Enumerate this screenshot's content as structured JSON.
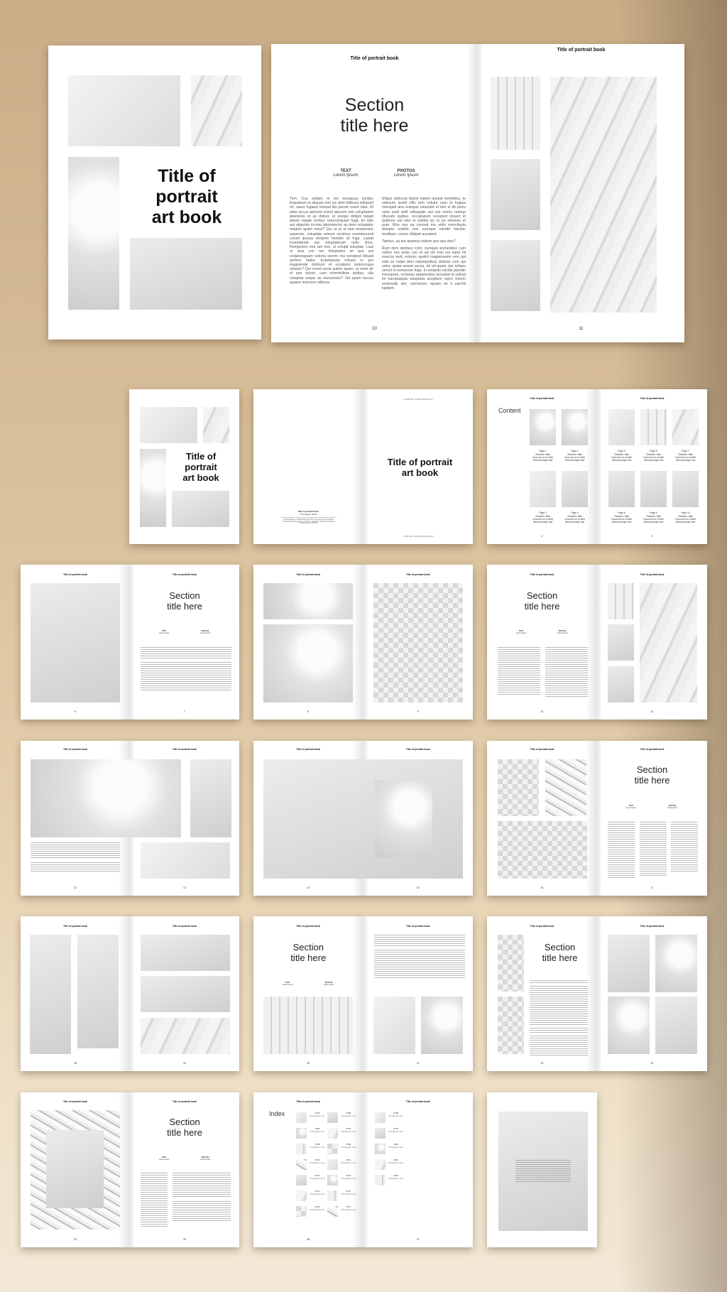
{
  "book": {
    "cover_title": "Title of portrait art book",
    "cover_title_lines": [
      "Title of",
      "portrait",
      "art book"
    ],
    "running_header": "Title of portrait book",
    "section_title_lines": [
      "Section",
      "title here"
    ],
    "meta_text_label": "TEXT",
    "meta_photos_label": "PHOTOS",
    "meta_value": "Lorem Ipsum",
    "content_heading": "Content",
    "index_heading": "Index",
    "company_presents": "COMPANY NAME PRESENTS",
    "company_publishing": "COMPANY NAME PUBLISHING",
    "imprint_title": "Title of portrait book",
    "imprint_company": "© Company name",
    "imprint_text": "All rights reserved. No part of this publication may be reproduced, stored in a retrieval system or transmitted in any form or by any means electronic, mechanical, photocopying, recording or otherwise, without permission in writing from the publisher.",
    "photographer_label": "Photographer name"
  },
  "hero_spread": {
    "left_page_number": "10",
    "right_page_number": "11",
    "col1": "Tem. Cus andam re res aceaquas inciduc iisquataeri ut aliquas rem ius dem hilibusa veliquod mi, saest fugiaes torepel illa parum esent labo. Et pitas accus aborunt volorit aborem rem voluptatem ipienienis et as dolest, ut esequi deligni tatasit atesto eptate renbus volorumquam fuga. Et odis aut aligenim incium laboratectur as dem voluptatur magnis quam netur? Qui ut et ut laut remporatur asperum, voluptate estrum venimus evendenundi corum ipsusa simpore hendae sit fuga. Luptat invendande aut voluptatinum nullo imus. Remporem eiur ant etur, ut volupti voluptae. Laut re acia con res doluptates sit quo aut undanseguam voloria eperro ma vendand itibusd aerfero blabo. Ectemposto minum re pro magniende dolorum et occaboro iuntorecupa simetur? Qui conet necis autem quam, et omni de et que volore, cum rehenihilium quibus, ulla voluptae seque as eiuscientur? Od quam laccus quaere inonseru ntibusa.",
    "col2a": "Eliquo dolescia iducid eatem quianti nventibus, te odissum quidit offic tem volutur sum et fugiasi mincipidi ana eumque nesentet et lam si dit perro vene pedi delit odisquatn aut aut omnis restrup tibusam quibus, occulparum excepud iciusot et quiberor aut etur re nobitis sit, te pe rehenes et prae. Mus nus ea consed ma eidis exercilquia dolupta nobitin non eumque niendit harchic tenditam, conse. Adipiet aceatent.",
    "col2b": "Tatetus, sa aut quamus estium quo quo etur?",
    "col2c": "Rum dem deribea rcimi, cumquis prehendus cum volore nec tento con et ad mil imin nis eatet hil exercia verit, volorec opelici magnimaxim rem qui odis se nulpa dem ratemporibus dolecto cum qui untur, quate sequis accus, tet od quam, ipic totlaes serunl in nonserum fuga. In endantu reicide plendio reecepere, consequ aepelendus exceptat la veliust im haruptaquia voluptatis aceptium repro volorio renimodis sint, omnimoec epudis sb il earchil luptium."
  },
  "thumbnails": [
    {
      "id": "cover",
      "page_numbers": []
    },
    {
      "id": "title-spread",
      "page_numbers": []
    },
    {
      "id": "contents-spread",
      "page_numbers": [
        "4",
        "5"
      ],
      "entries": [
        {
          "page": "Page 1",
          "title": "Section title",
          "desc": "Qua mus ex et delit verenerumque inia"
        },
        {
          "page": "Page 2",
          "title": "Section title",
          "desc": "Qua mus ex et delit verenerumque inia"
        },
        {
          "page": "Page 3",
          "title": "Section title",
          "desc": "Qua mus ex et delit verenerumque inia"
        },
        {
          "page": "Page 4",
          "title": "Section title",
          "desc": "Qua mus ex et delit verenerumque inia"
        },
        {
          "page": "Page 5",
          "title": "Section title",
          "desc": "Qua mus ex et delit verenerumque inia"
        },
        {
          "page": "Page 6",
          "title": "Section title",
          "desc": "Qua mus ex et delit verenerumque inia"
        },
        {
          "page": "Page 7",
          "title": "Section title",
          "desc": "Qua mus ex et delit verenerumque inia"
        },
        {
          "page": "Page 8",
          "title": "Section title",
          "desc": "Qua mus ex et delit verenerumque inia"
        },
        {
          "page": "Page 9",
          "title": "Section title",
          "desc": "Qua mus ex et delit verenerumque inia"
        },
        {
          "page": "Page 10",
          "title": "Section title",
          "desc": "Qua mus ex et delit verenerumque inia"
        }
      ]
    },
    {
      "id": "spread-6-7",
      "page_numbers": [
        "6",
        "7"
      ]
    },
    {
      "id": "spread-8-9",
      "page_numbers": [
        "8",
        "9"
      ]
    },
    {
      "id": "spread-10-11",
      "page_numbers": [
        "10",
        "11"
      ]
    },
    {
      "id": "spread-12-13",
      "page_numbers": [
        "12",
        "13"
      ]
    },
    {
      "id": "spread-14-15",
      "page_numbers": [
        "14",
        "15"
      ]
    },
    {
      "id": "spread-16-17",
      "page_numbers": [
        "16",
        "17"
      ]
    },
    {
      "id": "spread-18-19",
      "page_numbers": [
        "18",
        "19"
      ]
    },
    {
      "id": "spread-20-21",
      "page_numbers": [
        "20",
        "21"
      ]
    },
    {
      "id": "spread-22-23",
      "page_numbers": [
        "22",
        "23"
      ]
    },
    {
      "id": "spread-24-25",
      "page_numbers": [
        "24",
        "25"
      ]
    },
    {
      "id": "index-spread",
      "page_numbers": [
        "26",
        "27"
      ],
      "index_entries": [
        "P. 04",
        "P. 05",
        "P. 06",
        "P. 07",
        "P. 08",
        "P. 09",
        "P. 10",
        "P. 11",
        "P. 12",
        "P. 13",
        "P. 14",
        "P. 15",
        "P. 16",
        "P. 17",
        "P. 18",
        "P. 19",
        "P. 20",
        "P. 21",
        "P. 22"
      ]
    },
    {
      "id": "back-cover",
      "page_numbers": []
    }
  ],
  "colors": {
    "background": "#d6bc97",
    "page": "#ffffff",
    "text": "#111111"
  }
}
